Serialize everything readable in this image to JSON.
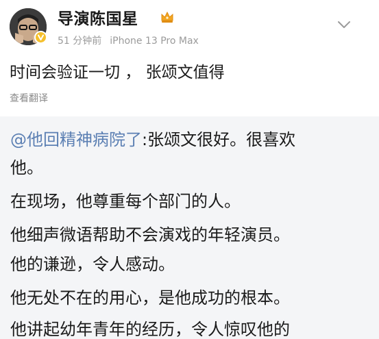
{
  "header": {
    "username": "导演陈国星",
    "time": "51 分钟前",
    "device": "iPhone 13 Pro Max",
    "badge_icon": "verified-v-icon",
    "member_icon": "crown-icon",
    "menu_icon": "chevron-down-icon"
  },
  "post": {
    "text": "时间会验证一切 ， 张颂文值得",
    "translate_label": "查看翻译"
  },
  "quote": {
    "mention": "@他回精神病院了",
    "lines": [
      ":张颂文很好。很喜欢",
      "他。",
      "在现场，他尊重每个部门的人。",
      "他细声微语帮助不会演戏的年轻演员。",
      "他的谦逊，令人感动。",
      "他无处不在的用心，是他成功的根本。",
      "他讲起幼年青年的经历，令人惊叹他的"
    ]
  },
  "colors": {
    "mention": "#5b7fb3",
    "meta_gray": "#9a9a9a",
    "quote_bg": "#f4f5f7",
    "badge_gold": "#f5c02c"
  }
}
